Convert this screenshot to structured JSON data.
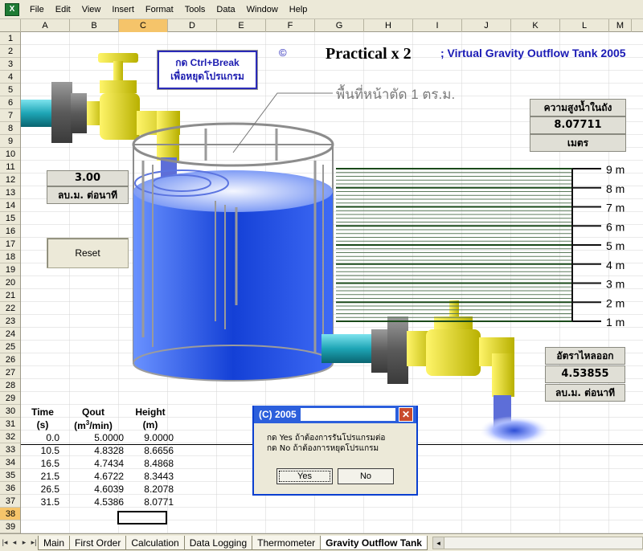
{
  "app": {
    "icon_letter": "X"
  },
  "menu": [
    "File",
    "Edit",
    "View",
    "Insert",
    "Format",
    "Tools",
    "Data",
    "Window",
    "Help"
  ],
  "columns": [
    "A",
    "B",
    "C",
    "D",
    "E",
    "F",
    "G",
    "H",
    "I",
    "J",
    "K",
    "L",
    "M"
  ],
  "selected_column": "C",
  "rows": [
    "1",
    "2",
    "3",
    "4",
    "5",
    "6",
    "7",
    "8",
    "9",
    "10",
    "11",
    "12",
    "13",
    "14",
    "15",
    "16",
    "17",
    "18",
    "19",
    "20",
    "21",
    "22",
    "23",
    "24",
    "25",
    "26",
    "27",
    "28",
    "29",
    "30",
    "31",
    "32",
    "33",
    "34",
    "35",
    "36",
    "37",
    "38",
    "39"
  ],
  "selected_row": "38",
  "header": {
    "copyright": "©",
    "title": "Practical x 2",
    "subtitle": "; Virtual Gravity Outflow Tank 2005",
    "stop_hint_line1": "กด Ctrl+Break",
    "stop_hint_line2": "เพื่อหยุดโปรแกรม",
    "area_label": "พื้นที่หน้าตัด 1 ตร.ม."
  },
  "inflow": {
    "value": "3.00",
    "unit": "ลบ.ม. ต่อนาที"
  },
  "reset_button": "Reset",
  "level": {
    "label": "ความสูงน้ำในถัง",
    "value": "8.07711",
    "unit": "เมตร"
  },
  "outflow": {
    "label": "อัตราไหลออก",
    "value": "4.53855",
    "unit": "ลบ.ม. ต่อนาที"
  },
  "scale_labels": [
    "9 m",
    "8 m",
    "7 m",
    "6 m",
    "5 m",
    "4 m",
    "3 m",
    "2 m",
    "1 m"
  ],
  "table": {
    "headers": [
      "Time",
      "Qout",
      "Height"
    ],
    "units": [
      "(s)",
      "(m3/min)",
      "(m)"
    ],
    "rows": [
      [
        "0.0",
        "5.0000",
        "9.0000"
      ],
      [
        "10.5",
        "4.8328",
        "8.6656"
      ],
      [
        "16.5",
        "4.7434",
        "8.4868"
      ],
      [
        "21.5",
        "4.6722",
        "8.3443"
      ],
      [
        "26.5",
        "4.6039",
        "8.2078"
      ],
      [
        "31.5",
        "4.5386",
        "8.0771"
      ]
    ]
  },
  "dialog": {
    "title": "(C) 2005",
    "line1": "กด Yes ถ้าต้องการรันโปรแกรมต่อ",
    "line2": "กด No ถ้าต้องการหยุดโปรแกรม",
    "yes": "Yes",
    "no": "No"
  },
  "sheet_tabs": [
    "Main",
    "First Order",
    "Calculation",
    "Data Logging",
    "Thermometer",
    "Gravity Outflow Tank"
  ],
  "active_tab": "Gravity Outflow Tank",
  "colors": {
    "water": "#1d4fd8",
    "valve": "#e8e000",
    "pipe": "#1fa3b3",
    "scale": "#1a4a1a"
  }
}
